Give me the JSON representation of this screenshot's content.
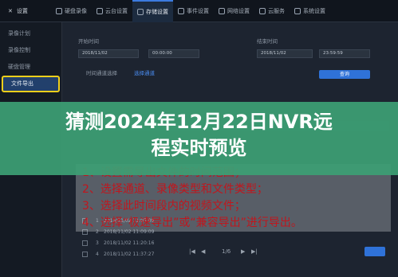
{
  "topbar": {
    "brand": "设置",
    "tabs": [
      "硬盘录像",
      "云台设置",
      "存储设置",
      "事件设置",
      "网络设置",
      "云服务",
      "系统设置"
    ],
    "active_index": 2
  },
  "sidebar": {
    "items": [
      "录像计划",
      "录像控制",
      "硬盘管理",
      "文件导出"
    ],
    "active_index": 3
  },
  "form": {
    "start_label": "开始时间",
    "end_label": "结束时间",
    "start_date": "2018/11/02",
    "start_time": "00:00:00",
    "end_date": "2018/11/02",
    "end_time": "23:59:59",
    "channel_label": "时间通道选择",
    "channel_link": "选择通道",
    "query_button": "查询"
  },
  "table": {
    "rows": [
      {
        "num": "1",
        "time": "2018/11/02 11:05:09"
      },
      {
        "num": "2",
        "time": "2018/11/02 11:09:09"
      },
      {
        "num": "3",
        "time": "2018/11/02 11:20:16"
      },
      {
        "num": "4",
        "time": "2018/11/02 11:37:27"
      }
    ]
  },
  "pager": {
    "page": "1/6"
  },
  "banner": {
    "line1": "猜测2024年12月22日NVR远",
    "line2": "程实时预览"
  },
  "notes": {
    "line1": "1、设置需导出文件的时间范围；",
    "line2": "2、选择通道、录像类型和文件类型；",
    "line3": "3、选择此时间段内的视频文件；",
    "line4": "4、选择“极速导出”或“兼容导出”进行导出。"
  },
  "colors": {
    "banner": "#3c9f74",
    "accent": "#2f72d8",
    "highlight": "#f0cf1a",
    "note_text": "#c0161d"
  }
}
